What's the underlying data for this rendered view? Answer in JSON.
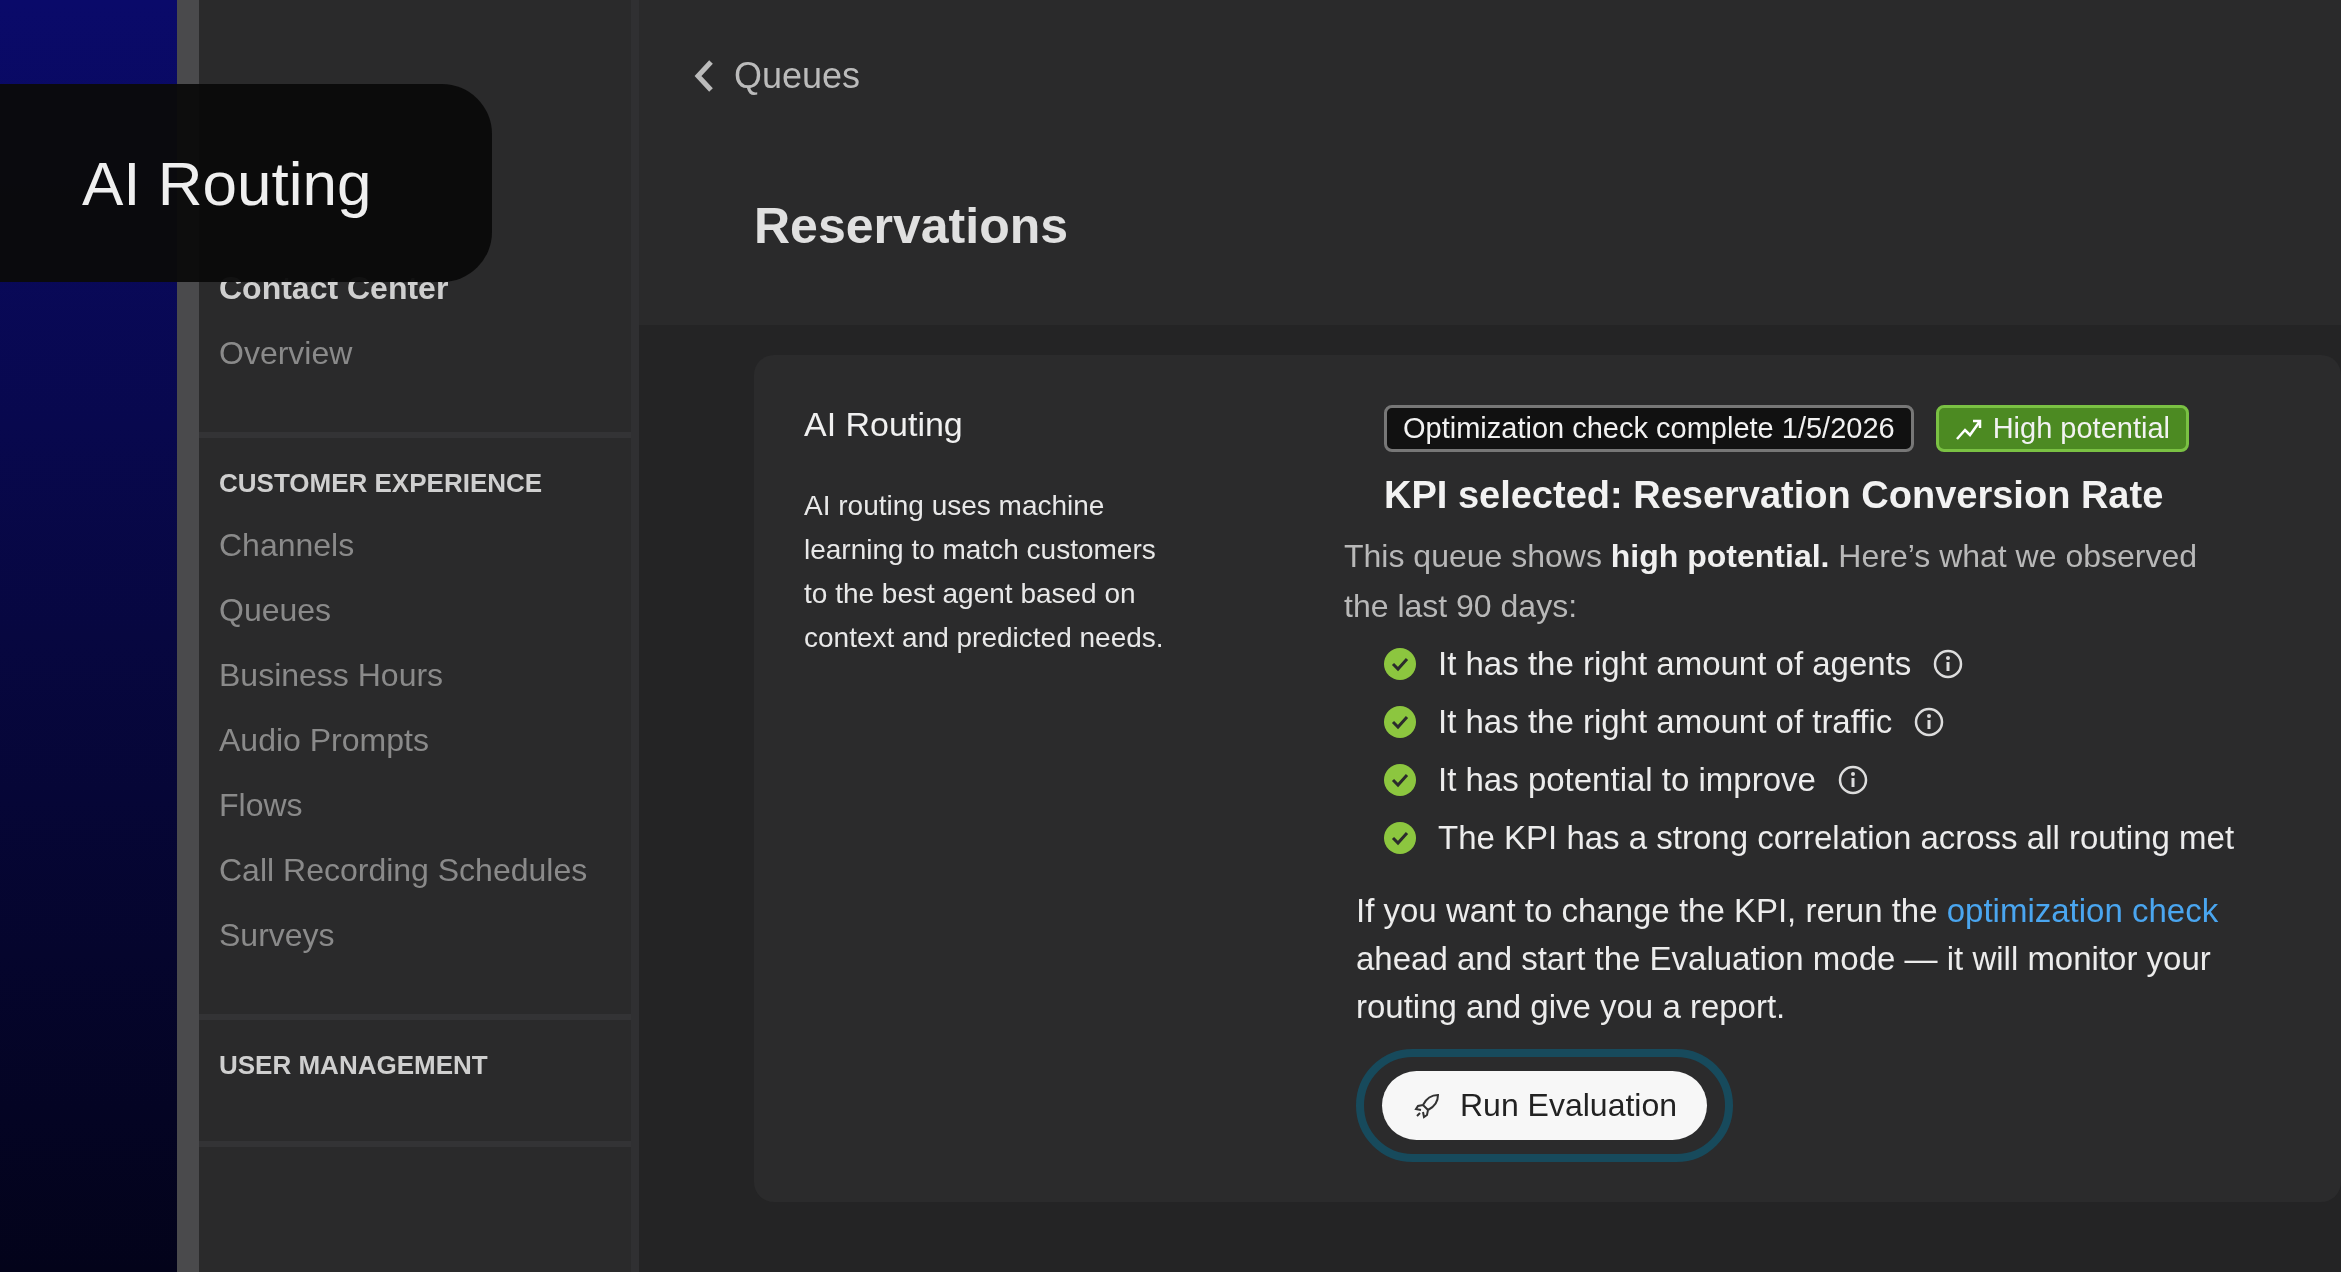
{
  "overlay_title": "AI Routing",
  "sidebar": {
    "sections": [
      {
        "heading": "Contact Center",
        "items": [
          "Overview"
        ],
        "kind": "title"
      },
      {
        "heading": "CUSTOMER EXPERIENCE",
        "items": [
          "Channels",
          "Queues",
          "Business Hours",
          "Audio Prompts",
          "Flows",
          "Call Recording Schedules",
          "Surveys"
        ],
        "kind": "caps"
      },
      {
        "heading": "USER MANAGEMENT",
        "kind": "caps"
      }
    ]
  },
  "back_link": "Queues",
  "page_title": "Reservations",
  "card": {
    "title": "AI Routing",
    "description": "AI routing uses machine learning to match customers to the best agent based on context and predicted needs.",
    "status_badge": "Optimization check complete 1/5/2026",
    "potential_badge": "High potential",
    "kpi_heading": "KPI selected: Reservation Conversion Rate",
    "intro_lines": [
      "This queue shows **high potential.** Here’s what we observed",
      "the last 90 days:"
    ],
    "checks": [
      {
        "text": "It has the right amount of agents",
        "info": true
      },
      {
        "text": "It has the right amount of traffic",
        "info": true
      },
      {
        "text": "It has potential to improve",
        "info": true
      },
      {
        "text": "The KPI has a strong correlation across all routing met",
        "info": false
      }
    ],
    "note_lead": "If you want to change the KPI, rerun the",
    "note_link": "optimization check",
    "note_lines": [
      "ahead and start the Evaluation mode — it will monitor your",
      "routing and give you a report."
    ],
    "button": "Run Evaluation"
  }
}
